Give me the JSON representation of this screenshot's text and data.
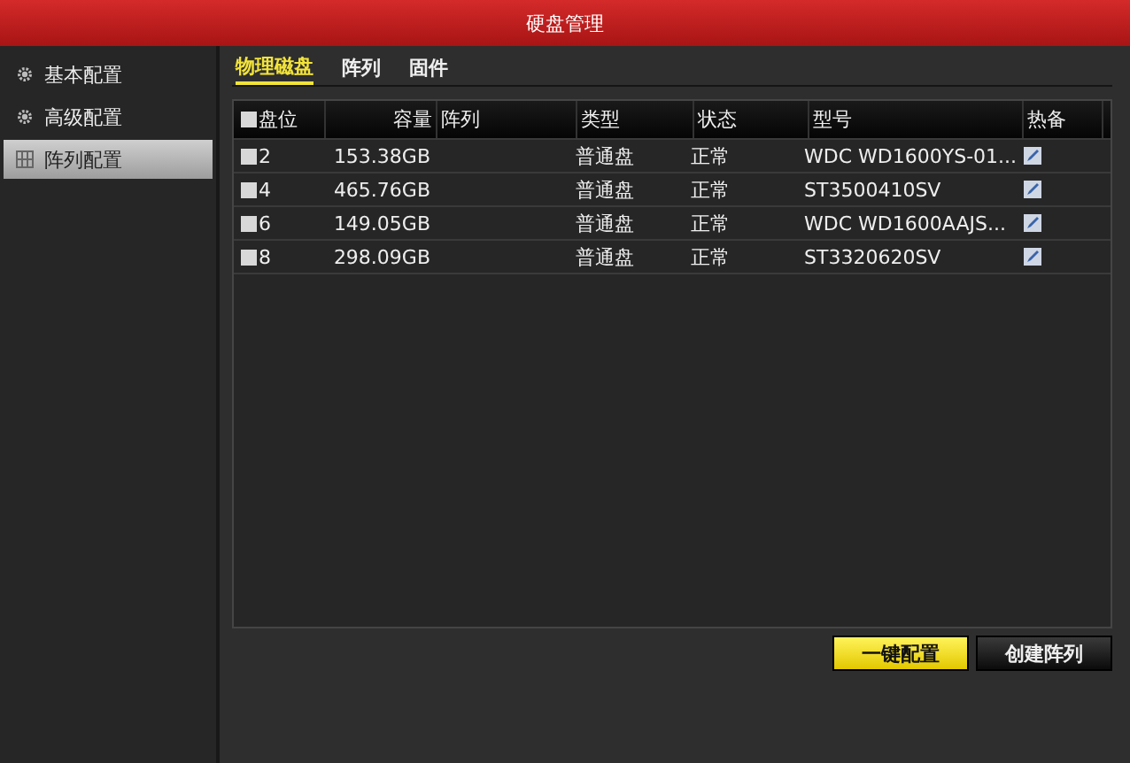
{
  "window": {
    "title": "硬盘管理"
  },
  "sidebar": {
    "items": [
      {
        "label": "基本配置",
        "kind": "gear",
        "selected": false
      },
      {
        "label": "高级配置",
        "kind": "gear",
        "selected": false
      },
      {
        "label": "阵列配置",
        "kind": "grid",
        "selected": true
      }
    ]
  },
  "tabs": [
    {
      "label": "物理磁盘",
      "selected": true
    },
    {
      "label": "阵列",
      "selected": false
    },
    {
      "label": "固件",
      "selected": false
    }
  ],
  "table": {
    "select_all_checked": false,
    "columns": [
      "盘位",
      "容量",
      "阵列",
      "类型",
      "状态",
      "型号",
      "热备"
    ],
    "rows": [
      {
        "checked": false,
        "slot": "2",
        "capacity": "153.38GB",
        "type": "普通盘",
        "status": "正常",
        "model": "WDC WD1600YS-01..."
      },
      {
        "checked": false,
        "slot": "4",
        "capacity": "465.76GB",
        "type": "普通盘",
        "status": "正常",
        "model": "ST3500410SV"
      },
      {
        "checked": false,
        "slot": "6",
        "capacity": "149.05GB",
        "type": "普通盘",
        "status": "正常",
        "model": "WDC WD1600AAJS..."
      },
      {
        "checked": false,
        "slot": "8",
        "capacity": "298.09GB",
        "type": "普通盘",
        "status": "正常",
        "model": "ST3320620SV"
      }
    ]
  },
  "buttons": [
    {
      "label": "一键配置",
      "primary": true
    },
    {
      "label": "创建阵列",
      "primary": false
    }
  ]
}
